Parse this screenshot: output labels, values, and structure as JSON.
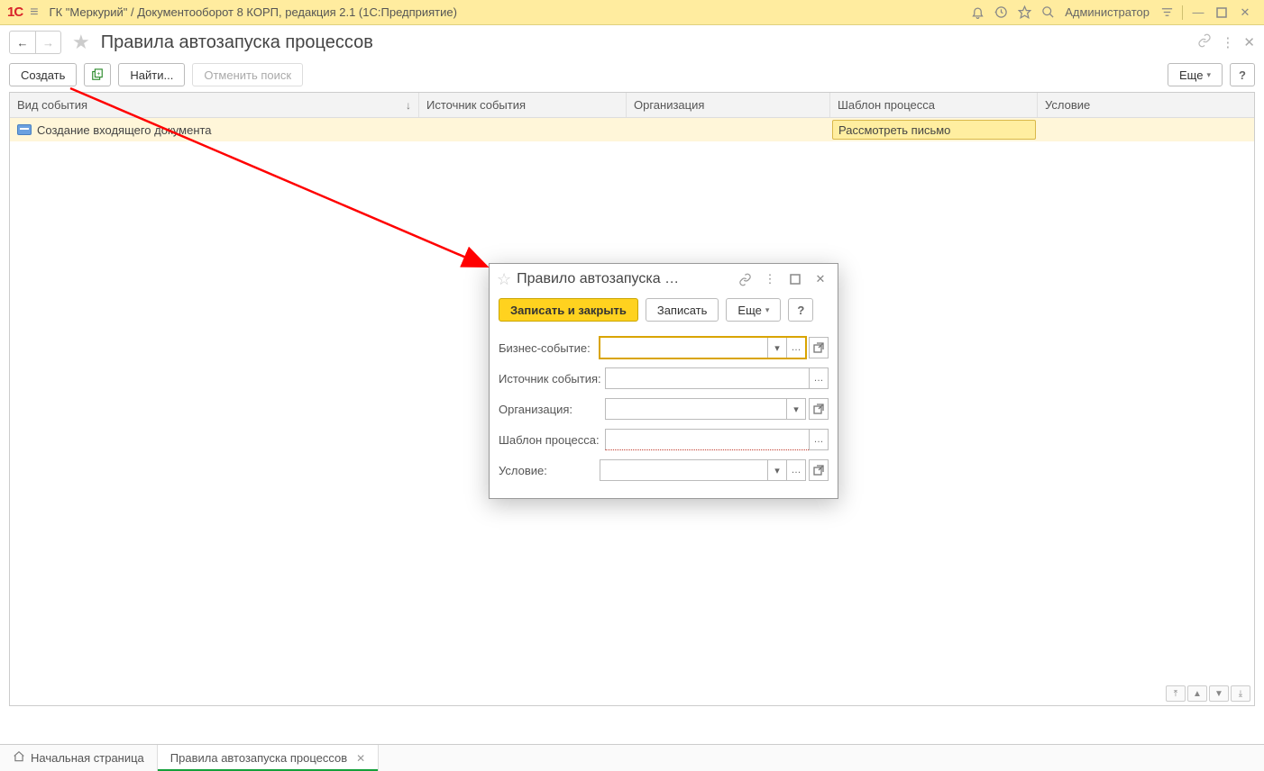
{
  "titlebar": {
    "app_title": "ГК \"Меркурий\" / Документооборот 8 КОРП, редакция 2.1  (1С:Предприятие)",
    "user": "Администратор"
  },
  "page": {
    "title": "Правила автозапуска процессов"
  },
  "toolbar": {
    "create": "Создать",
    "find": "Найти...",
    "cancel_search": "Отменить поиск",
    "more": "Еще",
    "help": "?"
  },
  "table": {
    "columns": {
      "event_type": "Вид события",
      "event_source": "Источник события",
      "organization": "Организация",
      "process_template": "Шаблон процесса",
      "condition": "Условие"
    },
    "rows": [
      {
        "event_type": "Создание входящего документа",
        "event_source": "",
        "organization": "",
        "process_template": "Рассмотреть письмо",
        "condition": ""
      }
    ]
  },
  "dialog": {
    "title": "Правило автозапуска …",
    "buttons": {
      "save_close": "Записать и закрыть",
      "save": "Записать",
      "more": "Еще",
      "help": "?"
    },
    "fields": {
      "business_event": {
        "label": "Бизнес-событие:",
        "value": ""
      },
      "event_source": {
        "label": "Источник события:",
        "value": ""
      },
      "organization": {
        "label": "Организация:",
        "value": ""
      },
      "process_template": {
        "label": "Шаблон процесса:",
        "value": ""
      },
      "condition": {
        "label": "Условие:",
        "value": ""
      }
    }
  },
  "bottom_tabs": {
    "home": "Начальная страница",
    "current": "Правила автозапуска процессов"
  }
}
